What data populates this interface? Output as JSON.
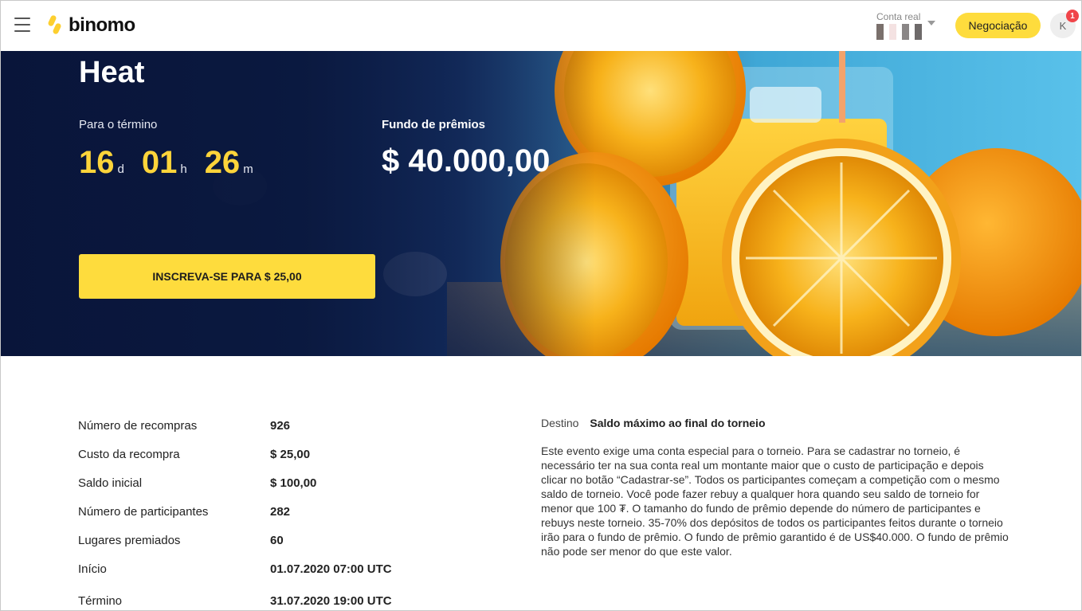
{
  "header": {
    "logo_text": "binomo",
    "account_label": "Conta real",
    "trade_button": "Negociação",
    "avatar_initial": "K",
    "notification_count": "1",
    "brand_color": "#fedc3d"
  },
  "hero": {
    "title": "Heat",
    "countdown_label": "Para o término",
    "countdown": {
      "days": "16",
      "days_unit": "d",
      "hours": "01",
      "hours_unit": "h",
      "minutes": "26",
      "minutes_unit": "m"
    },
    "prize_label": "Fundo de prêmios",
    "prize_value": "$ 40.000,00",
    "signup_button": "INSCREVA-SE PARA $ 25,00"
  },
  "details": [
    {
      "label": "Número de recompras",
      "value": "926"
    },
    {
      "label": "Custo da recompra",
      "value": "$ 25,00"
    },
    {
      "label": "Saldo inicial",
      "value": "$ 100,00"
    },
    {
      "label": "Número de participantes",
      "value": "282"
    },
    {
      "label": "Lugares premiados",
      "value": "60"
    },
    {
      "label": "Início",
      "value": "01.07.2020 07:00 UTC"
    },
    {
      "label": "Término",
      "value": "31.07.2020 19:00 UTC"
    }
  ],
  "target": {
    "label": "Destino",
    "value": "Saldo máximo ao final do torneio"
  },
  "description": "Este evento exige uma conta especial para o torneio. Para se cadastrar no torneio, é necessário ter na sua conta real um montante maior que o custo de participação e depois clicar no botão “Cadastrar-se”. Todos os participantes começam a competição com o mesmo saldo de torneio. Você pode fazer rebuy a qualquer hora quando seu saldo de torneio for menor que 100 ₮. O tamanho do fundo de prêmio depende do número de participantes e rebuys neste torneio. 35-70% dos depósitos de todos os participantes feitos durante o torneio irão para o fundo de prêmio. O fundo de prêmio garantido é de US$40.000. O fundo de prêmio não pode ser menor do que este valor."
}
